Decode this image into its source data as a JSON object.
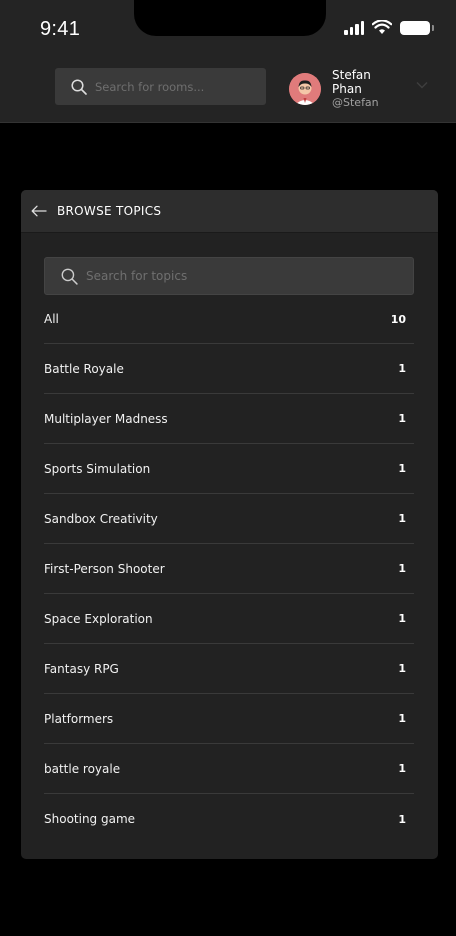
{
  "status_bar": {
    "time": "9:41"
  },
  "header": {
    "search_placeholder": "Search for rooms...",
    "user": {
      "name": "Stefan Phan",
      "handle": "@Stefan"
    }
  },
  "panel": {
    "title": "BROWSE TOPICS",
    "search_placeholder": "Search for topics",
    "topics": [
      {
        "name": "All",
        "count": "10"
      },
      {
        "name": "Battle Royale",
        "count": "1"
      },
      {
        "name": "Multiplayer Madness",
        "count": "1"
      },
      {
        "name": "Sports Simulation",
        "count": "1"
      },
      {
        "name": "Sandbox Creativity",
        "count": "1"
      },
      {
        "name": "First-Person Shooter",
        "count": "1"
      },
      {
        "name": "Space Exploration",
        "count": "1"
      },
      {
        "name": "Fantasy RPG",
        "count": "1"
      },
      {
        "name": "Platformers",
        "count": "1"
      },
      {
        "name": "battle royale",
        "count": "1"
      },
      {
        "name": "Shooting game",
        "count": "1"
      }
    ]
  },
  "colors": {
    "background": "#000000",
    "header": "#242424",
    "panel": "#222222",
    "input": "#3a3a3a",
    "avatar": "#e07b7b"
  },
  "icons": [
    "search-icon",
    "back-arrow-icon",
    "chevron-down-icon",
    "signal-icon",
    "wifi-icon",
    "battery-icon"
  ]
}
